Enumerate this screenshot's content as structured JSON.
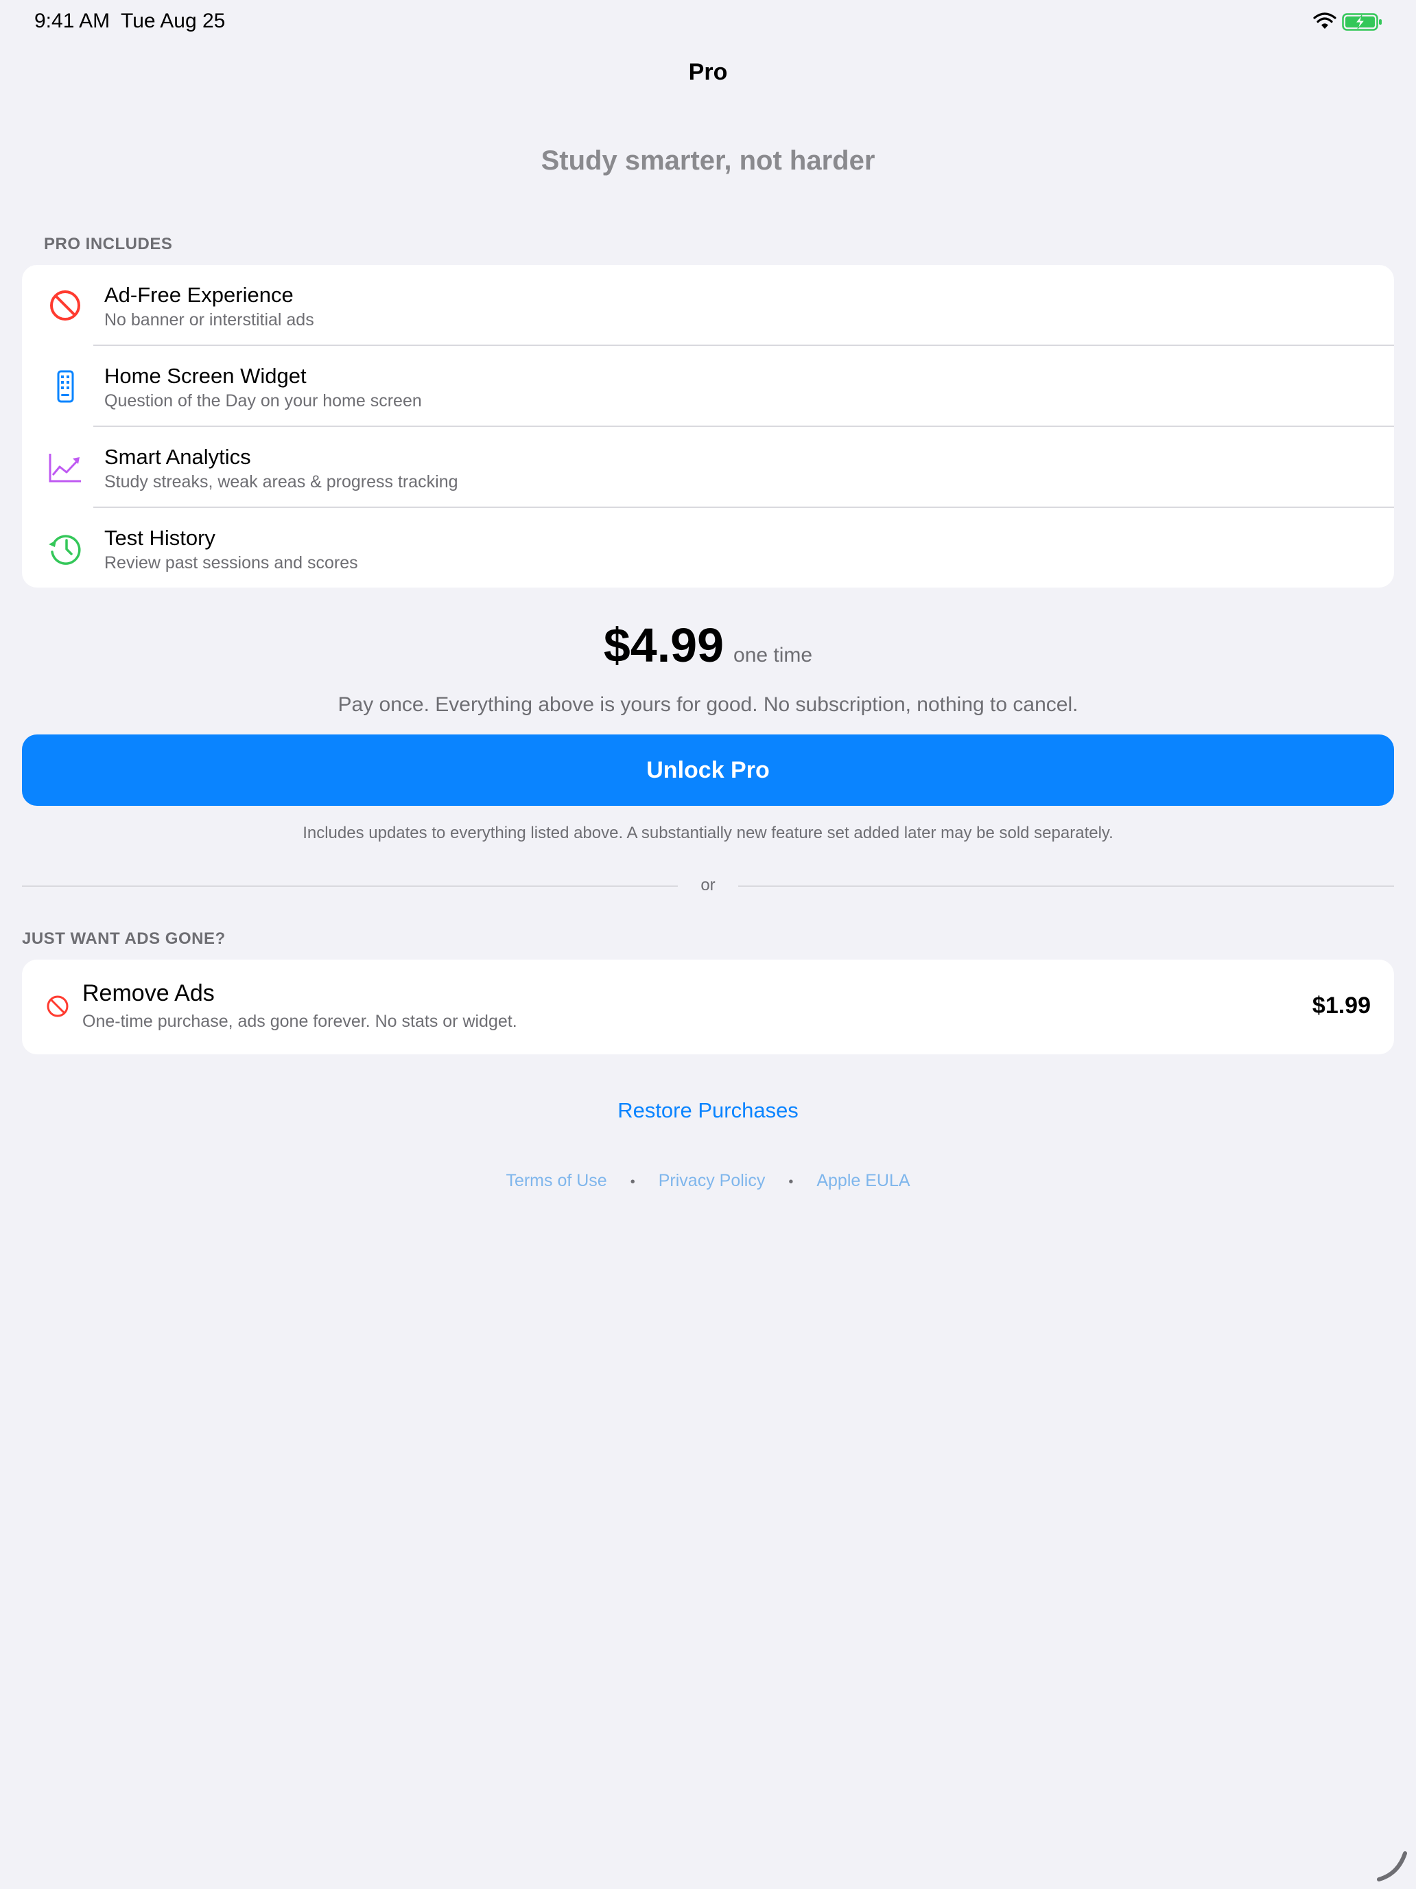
{
  "status_bar": {
    "time": "9:41 AM",
    "date": "Tue Aug 25",
    "icons": [
      "wifi-icon",
      "battery-charging-icon"
    ],
    "battery_color": "#34c759"
  },
  "nav": {
    "title": "Pro"
  },
  "tagline": "Study smarter, not harder",
  "pro_includes": {
    "header": "PRO INCLUDES",
    "items": [
      {
        "title": "Ad-Free Experience",
        "subtitle": "No banner or interstitial ads",
        "icon": "no-ads-icon",
        "color": "#ff3b30"
      },
      {
        "title": "Home Screen Widget",
        "subtitle": "Question of the Day on your home screen",
        "icon": "widget-phone-icon",
        "color": "#0a84ff"
      },
      {
        "title": "Smart Analytics",
        "subtitle": "Study streaks, weak areas & progress tracking",
        "icon": "analytics-chart-icon",
        "color": "#bf5af2"
      },
      {
        "title": "Test History",
        "subtitle": "Review past sessions and scores",
        "icon": "history-clock-icon",
        "color": "#34c759"
      }
    ]
  },
  "pricing": {
    "price": "$4.99",
    "unit": "one time",
    "note": "Pay once. Everything above is yours for good. No subscription, nothing to cancel.",
    "button_label": "Unlock Pro",
    "button_color": "#0a84ff",
    "updates_note": "Includes updates to everything listed above. A substantially new feature set added later may be sold separately."
  },
  "divider": {
    "label": "or"
  },
  "remove_ads": {
    "header": "JUST WANT ADS GONE?",
    "title": "Remove Ads",
    "subtitle": "One-time purchase, ads gone forever. No stats or widget.",
    "price": "$1.99",
    "icon": "no-ads-icon"
  },
  "restore": {
    "label": "Restore Purchases"
  },
  "legal": {
    "links": [
      "Terms of Use",
      "Privacy Policy",
      "Apple EULA"
    ],
    "separator": "•"
  },
  "accent_color": "#0a84ff"
}
